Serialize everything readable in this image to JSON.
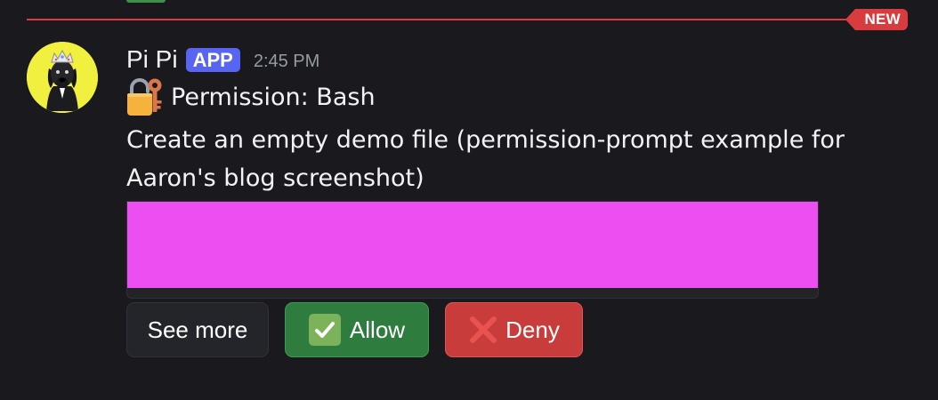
{
  "divider": {
    "badge_label": "NEW"
  },
  "message": {
    "username": "Pi Pi",
    "app_tag": "APP",
    "timestamp": "2:45 PM",
    "title_icon": "lock-with-key-icon",
    "title": "Permission: Bash",
    "description_lines": [
      "Create an empty demo file (permission-prompt example for",
      "Aaron's blog screenshot)"
    ]
  },
  "buttons": {
    "see_more": "See more",
    "allow": "Allow",
    "allow_icon": "check-mark-icon",
    "deny": "Deny",
    "deny_icon": "cross-mark-icon"
  },
  "colors": {
    "background": "#1a1a1e",
    "new_divider": "#d83c3e",
    "app_tag": "#5865f2",
    "allow_button": "#2f7c3f",
    "deny_button": "#c93c3c",
    "redaction": "#ec4ef2"
  }
}
